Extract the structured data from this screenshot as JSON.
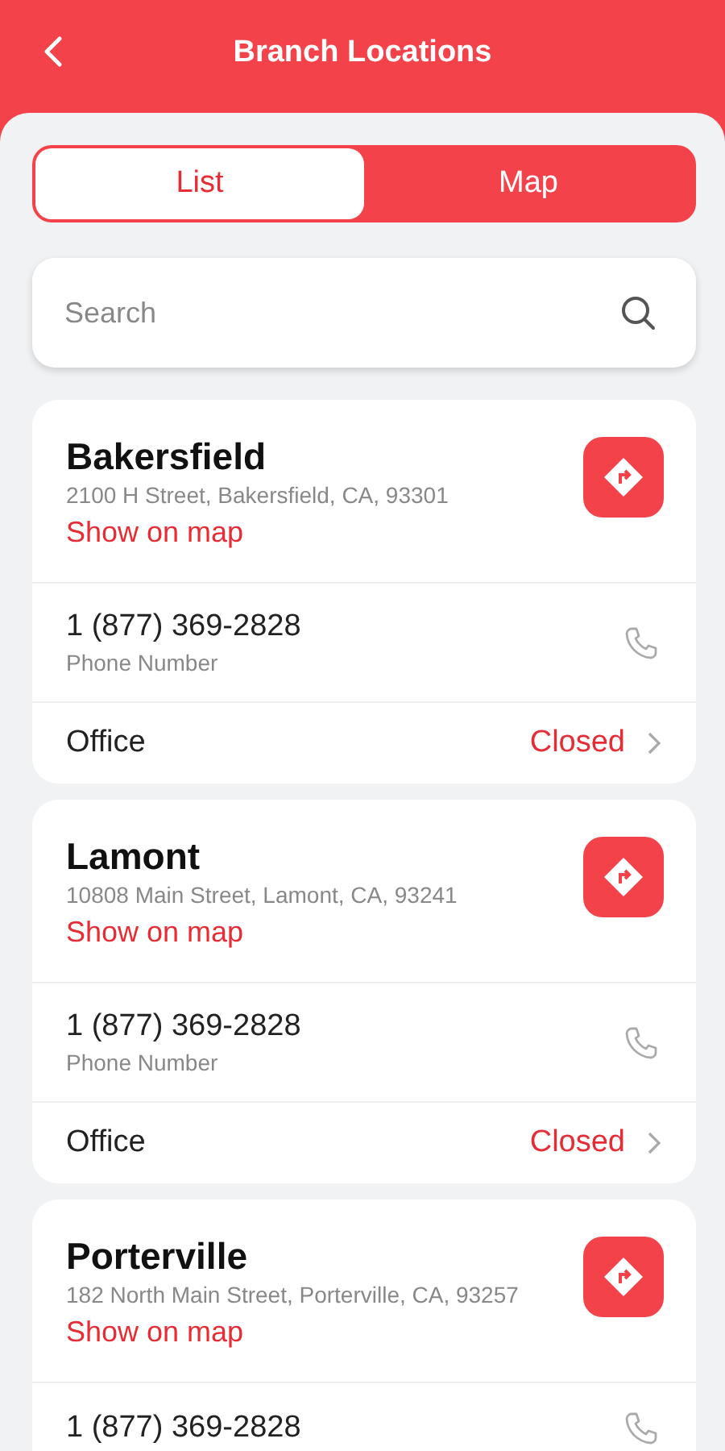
{
  "header": {
    "title": "Branch Locations"
  },
  "tabs": [
    {
      "label": "List",
      "selected": true
    },
    {
      "label": "Map",
      "selected": false
    }
  ],
  "search": {
    "placeholder": "Search"
  },
  "branches": [
    {
      "name": "Bakersfield",
      "address": "2100 H Street, Bakersfield, CA, 93301",
      "map_link": "Show on map",
      "phone": "1 (877) 369-2828",
      "phone_label": "Phone Number",
      "office_label": "Office",
      "office_status": "Closed"
    },
    {
      "name": "Lamont",
      "address": "10808 Main Street, Lamont, CA, 93241",
      "map_link": "Show on map",
      "phone": "1 (877) 369-2828",
      "phone_label": "Phone Number",
      "office_label": "Office",
      "office_status": "Closed"
    },
    {
      "name": "Porterville",
      "address": "182 North Main Street, Porterville, CA, 93257",
      "map_link": "Show on map",
      "phone": "1 (877) 369-2828"
    }
  ]
}
